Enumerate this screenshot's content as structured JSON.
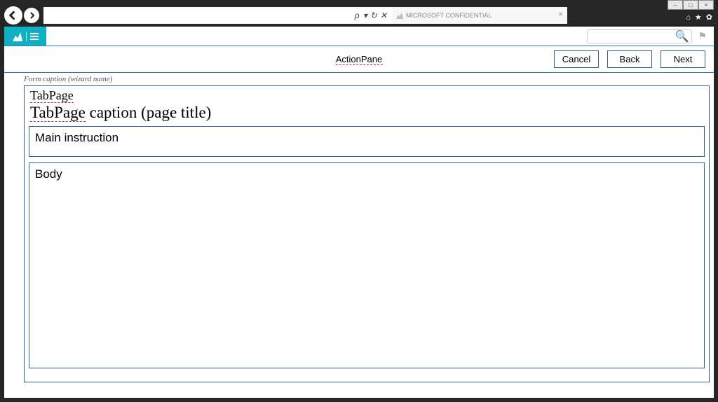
{
  "window": {
    "minimize": "–",
    "maximize": "□",
    "close": "×"
  },
  "sys": {
    "home": "⌂",
    "star": "★",
    "gear": "✿"
  },
  "browser": {
    "tab_label": "MICROSOFT CONFIDENTIAL",
    "addr_search": "🔍 ▾",
    "addr_refresh": "↻",
    "addr_stop": "✕"
  },
  "ribbon": {
    "search_placeholder": ""
  },
  "actionpane": {
    "label": "ActionPane",
    "cancel": "Cancel",
    "back": "Back",
    "next": "Next"
  },
  "form": {
    "caption": "Form caption (wizard name)",
    "tabpage": "TabPage",
    "tabpage_caption_prefix": "TabPage",
    "tabpage_caption_suffix": " caption (page title)",
    "main_instruction": "Main instruction",
    "body": "Body"
  }
}
